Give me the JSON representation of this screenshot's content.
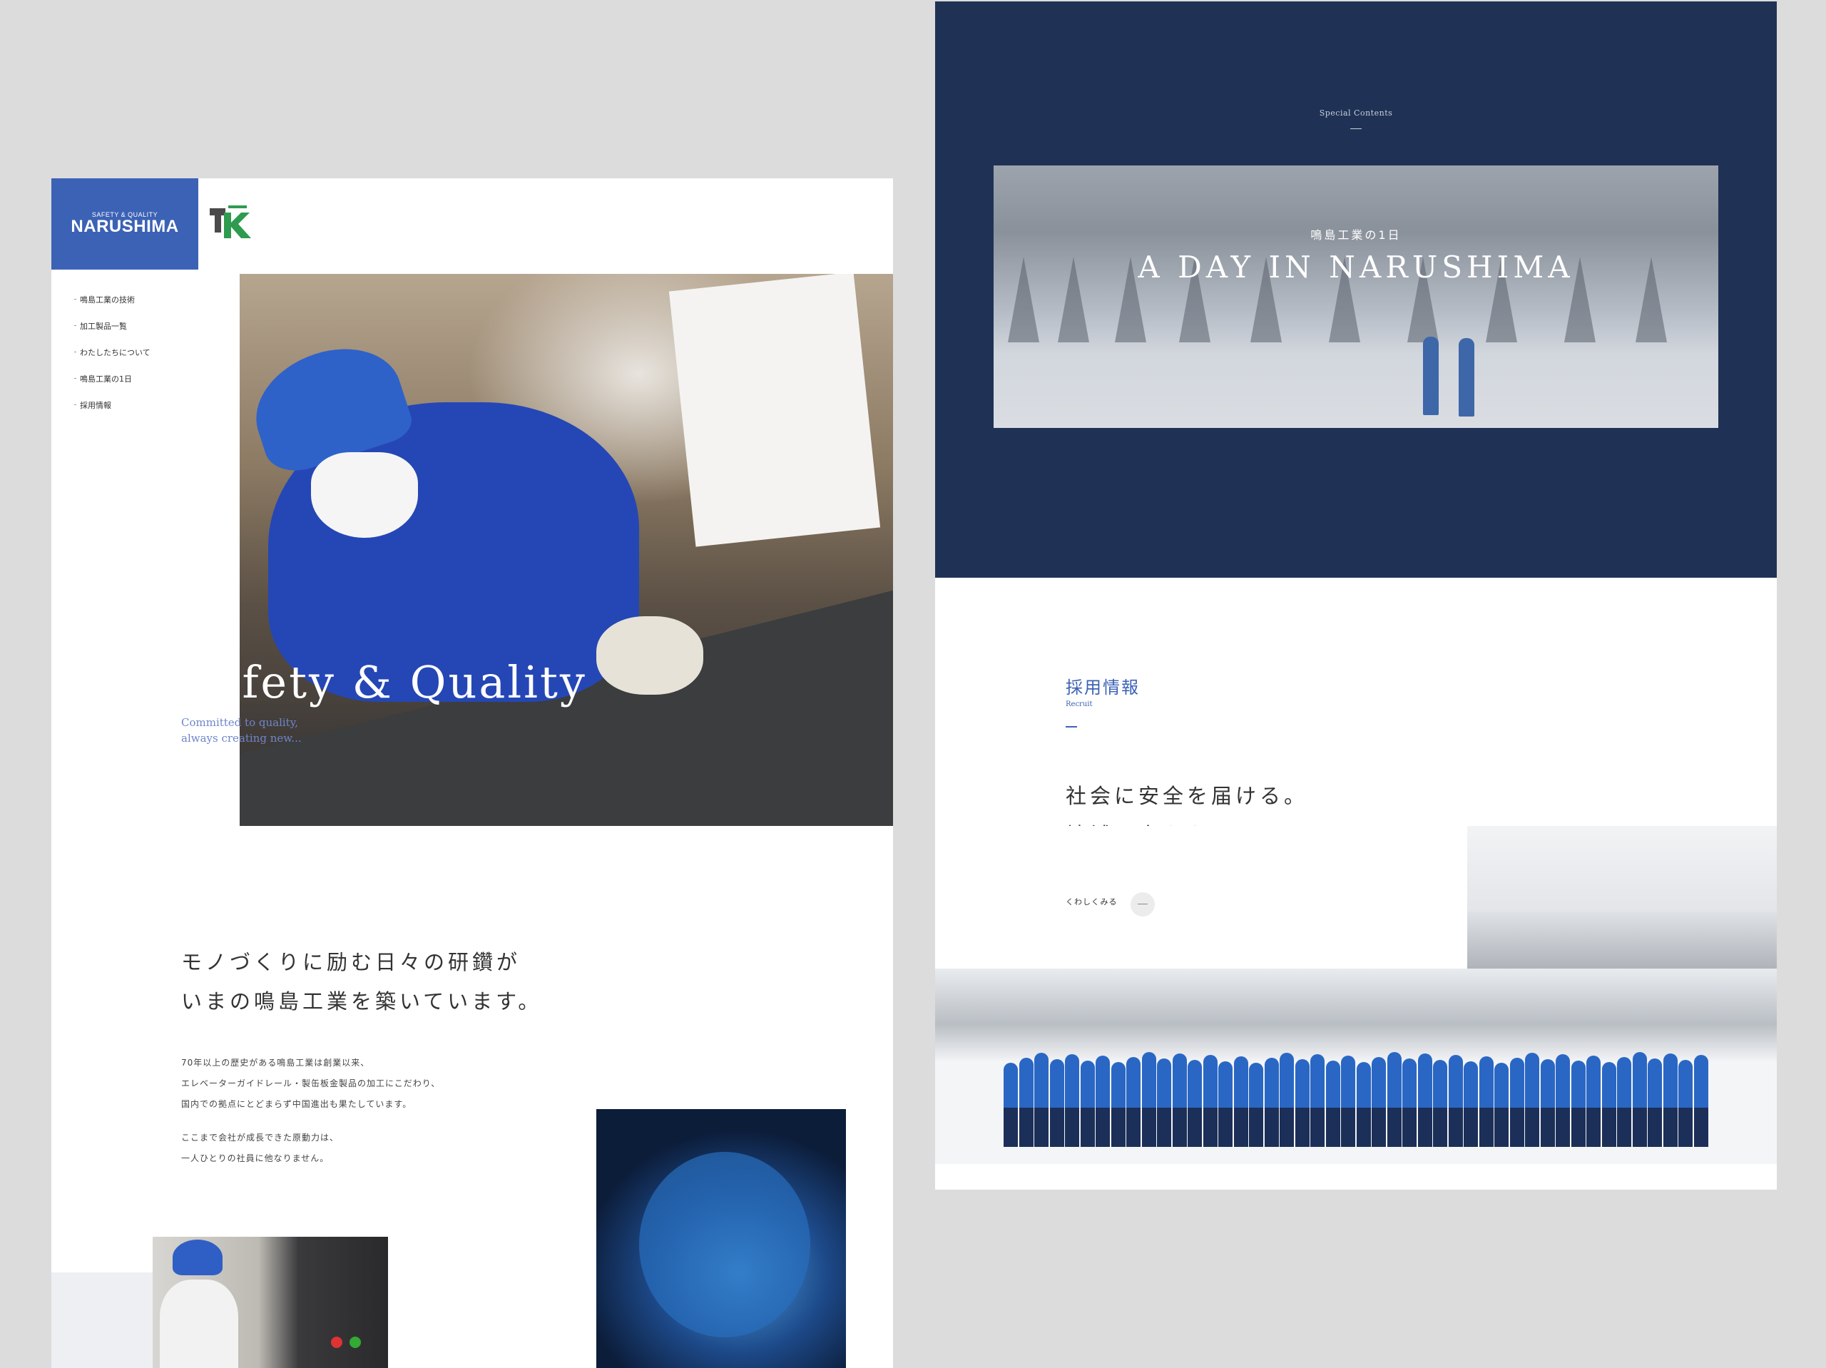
{
  "left_page": {
    "logo": {
      "tagline": "SAFETY & QUALITY",
      "name": "NARUSHIMA",
      "color": "#3c62b5"
    },
    "partner_logo_icon": "tk-logo-icon",
    "nav": {
      "items": [
        {
          "label": "鳴島工業の技術"
        },
        {
          "label": "加工製品一覧"
        },
        {
          "label": "わたしたちについて"
        },
        {
          "label": "鳴島工業の1日"
        },
        {
          "label": "採用情報"
        }
      ]
    },
    "hero": {
      "title": "Safety & Quality",
      "subtitle_line1": "Committed to quality,",
      "subtitle_line2": "always creating new..."
    },
    "intro": {
      "heading_line1": "モノづくりに励む日々の研鑽が",
      "heading_line2": "いまの鳴島工業を築いています。",
      "body_line1": "70年以上の歴史がある鳴島工業は創業以来、",
      "body_line2": "エレベーターガイドレール・製缶板金製品の加工にこだわり、",
      "body_line3": "国内での拠点にとどまらず中国進出も果たしています。",
      "body_line4": "ここまで会社が成長できた原動力は、",
      "body_line5": "一人ひとりの社員に他なりません。"
    }
  },
  "right_page": {
    "navy_color": "#1f3256",
    "special": {
      "label": "Special Contents",
      "banner_sub": "鳴島工業の1日",
      "banner_title": "A DAY IN NARUSHIMA"
    },
    "recruit": {
      "title_ja": "採用情報",
      "title_en": "Recruit",
      "heading_line1": "社会に安全を届ける。",
      "heading_line2": "地域に安心を届ける。",
      "more_label": "くわしくみる",
      "arrow_icon": "arrow-right-icon"
    }
  }
}
